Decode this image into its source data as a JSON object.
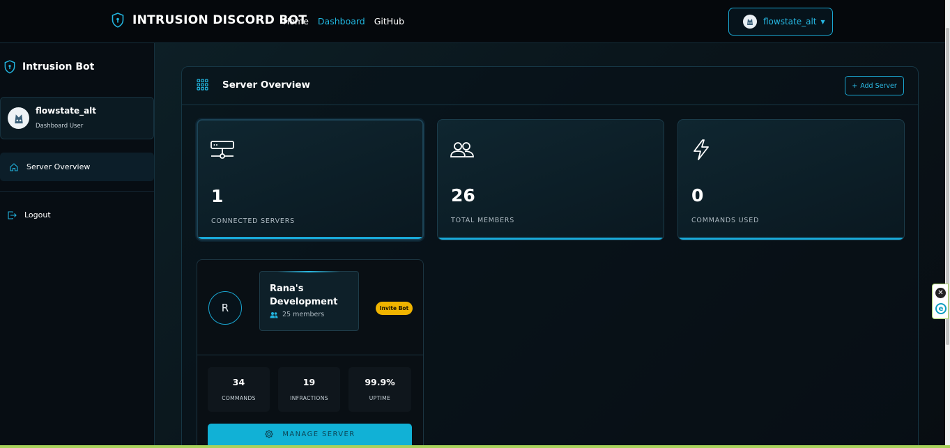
{
  "topbar": {
    "brand_title": "INTRUSION DISCORD BOT",
    "nav": [
      {
        "label": "Home",
        "active": false
      },
      {
        "label": "Dashboard",
        "active": true
      },
      {
        "label": "GitHub",
        "active": false
      }
    ],
    "user_button_label": "flowstate_alt"
  },
  "sidebar": {
    "brand_title": "Intrusion Bot",
    "user": {
      "name": "flowstate_alt",
      "role": "Dashboard User"
    },
    "items": [
      {
        "label": "Server Overview",
        "icon": "home-icon",
        "active": true
      },
      {
        "label": "Logout",
        "icon": "logout-icon",
        "active": false
      }
    ]
  },
  "panel": {
    "title": "Server Overview",
    "add_button_label": "Add Server",
    "stats": [
      {
        "value": "1",
        "label": "CONNECTED SERVERS",
        "icon": "server-icon"
      },
      {
        "value": "26",
        "label": "TOTAL MEMBERS",
        "icon": "users-icon"
      },
      {
        "value": "0",
        "label": "COMMANDS USED",
        "icon": "lightning-icon"
      }
    ],
    "server": {
      "initial": "R",
      "name": "Rana's Development",
      "members": "25 members",
      "badge": "Invite Bot",
      "stats": [
        {
          "value": "34",
          "label": "COMMANDS"
        },
        {
          "value": "19",
          "label": "INFRACTIONS"
        },
        {
          "value": "99.9%",
          "label": "UPTIME"
        }
      ],
      "manage_label": "MANAGE SERVER"
    }
  },
  "colors": {
    "accent": "#19a9d8",
    "badge": "#f0b400",
    "background": "#070b10"
  }
}
